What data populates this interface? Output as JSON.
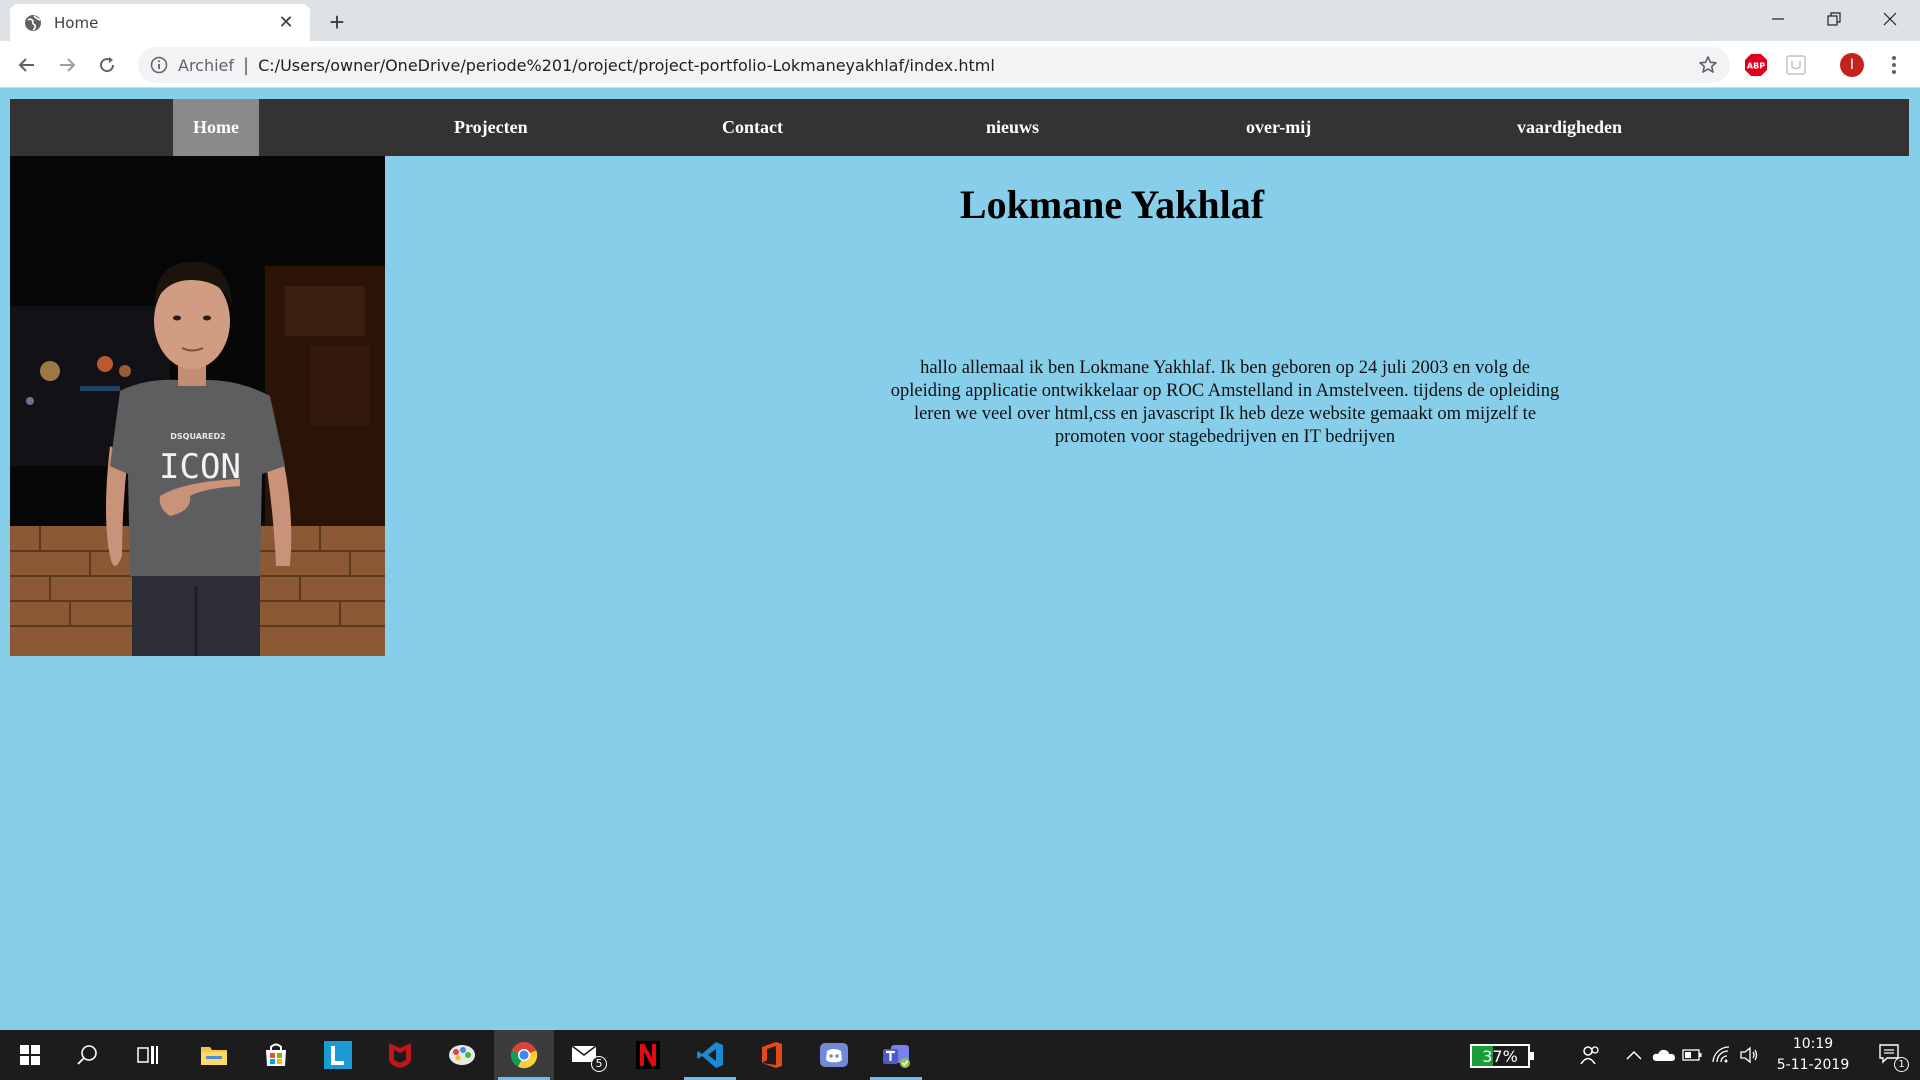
{
  "browser": {
    "tab_title": "Home",
    "tab_close": "✕",
    "new_tab": "+",
    "chip": "Archief",
    "separator": "|",
    "url": "C:/Users/owner/OneDrive/periode%201/oroject/project-portfolio-Lokmaneyakhlaf/index.html",
    "profile_initial": "I",
    "adblock_label": "ABP",
    "colors": {
      "tabstrip": "#dee1e6",
      "toolbar": "#ffffff",
      "omnibox": "#f1f3f4"
    }
  },
  "site": {
    "nav": [
      {
        "label": "Home",
        "active": true
      },
      {
        "label": "Projecten",
        "active": false
      },
      {
        "label": "Contact",
        "active": false
      },
      {
        "label": "nieuws",
        "active": false
      },
      {
        "label": "over-mij",
        "active": false
      },
      {
        "label": "vaardigheden",
        "active": false
      }
    ],
    "photo_shirt_brand": "DSQUARED2",
    "photo_shirt_text": "ICON",
    "heading": "Lokmane Yakhlaf",
    "intro": "hallo allemaal ik ben Lokmane Yakhlaf. Ik ben geboren op 24 juli 2003 en volg de opleiding applicatie ontwikkelaar op ROC Amstelland in Amstelveen. tijdens de opleiding leren we veel over html,css en javascript Ik heb deze website gemaakt om mijzelf te promoten voor stagebedrijven en IT bedrijven",
    "colors": {
      "background": "#87ceeb",
      "nav": "#333333",
      "nav_active": "#8a8a8a"
    }
  },
  "taskbar": {
    "mail_badge": "5",
    "battery_percent": "37%",
    "battery_level": 0.37,
    "time": "10:19",
    "date": "5-11-2019",
    "notification_count": "1",
    "apps": [
      "start-icon",
      "search-icon",
      "task-view-icon",
      "file-explorer-icon",
      "store-icon",
      "l-app-icon",
      "mcafee-icon",
      "paint-icon",
      "chrome-icon",
      "mail-icon",
      "netflix-icon",
      "vscode-icon",
      "office-icon",
      "discord-icon",
      "teams-icon"
    ]
  }
}
